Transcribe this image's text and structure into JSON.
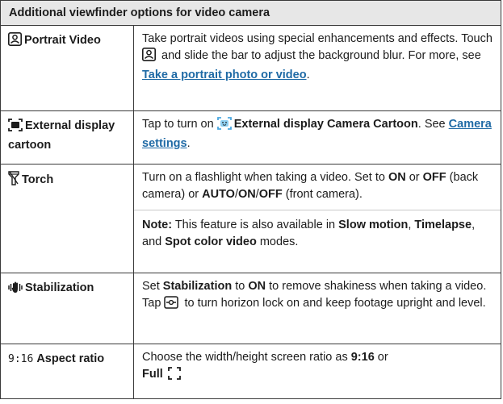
{
  "table": {
    "title": "Additional viewfinder options for video camera",
    "rows": [
      {
        "name": "Portrait Video",
        "icon": "portrait-icon",
        "desc": {
          "t1": "Take portrait videos using special enhancements and effects. Touch ",
          "t2": " and slide the bar to adjust the background blur. For more, see ",
          "link": "Take a portrait photo or video",
          "t3": "."
        }
      },
      {
        "name": "External display cartoon",
        "icon": "external-display-icon",
        "desc": {
          "t1": "Tap to turn on ",
          "b1": "External display Camera Cartoon",
          "t2": ". See ",
          "link": "Camera settings",
          "t3": "."
        }
      },
      {
        "name": "Torch",
        "icon": "torch-icon",
        "desc": {
          "t1": "Turn on a flashlight when taking a video. Set to ",
          "b1": "ON",
          "t2": " or ",
          "b2": "OFF",
          "t3": " (back camera) or ",
          "b3": "AUTO",
          "s1": "/",
          "b4": "ON",
          "s2": "/",
          "b5": "OFF",
          "t4": " (front camera)."
        },
        "note": {
          "label": "Note:",
          "t1": " This feature is also available in ",
          "b1": "Slow motion",
          "t2": ", ",
          "b2": "Timelapse",
          "t3": ", and ",
          "b3": "Spot color video",
          "t4": " modes."
        }
      },
      {
        "name": "Stabilization",
        "icon": "stabilization-icon",
        "desc": {
          "t1": "Set ",
          "b1": "Stabilization",
          "t2": " to ",
          "b2": "ON",
          "t3": " to remove shakiness when taking a video. Tap ",
          "t4": " to turn horizon lock on and keep footage upright and level."
        }
      },
      {
        "name": "Aspect ratio",
        "prefix": "9:16",
        "desc": {
          "t1": "Choose the width/height screen ratio as ",
          "b1": "9:16",
          "t2": " or ",
          "b2": "Full"
        }
      }
    ]
  },
  "colors": {
    "link": "#1f6aa5",
    "header_bg": "#e7e7e7",
    "border": "#3a3a3a"
  }
}
